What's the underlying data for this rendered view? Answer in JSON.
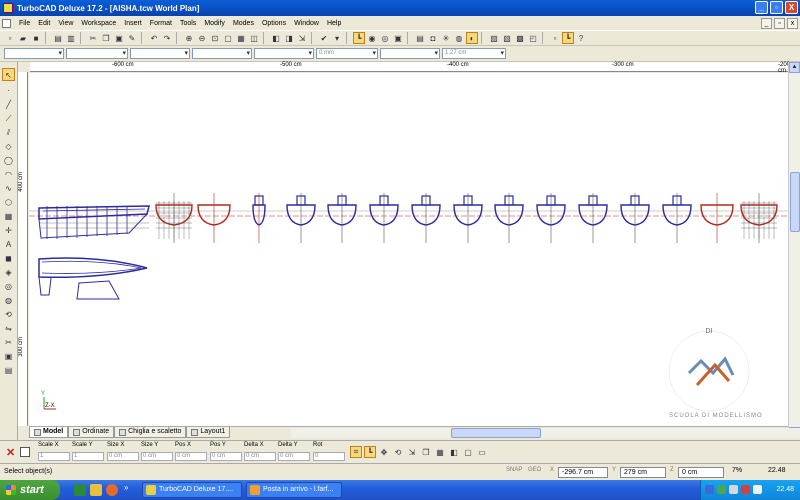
{
  "window": {
    "title": "TurboCAD Deluxe 17.2 - [AISHA.tcw World Plan]",
    "controls": [
      "_",
      "▫",
      "X"
    ]
  },
  "menu": {
    "items": [
      "File",
      "Edit",
      "View",
      "Workspace",
      "Insert",
      "Format",
      "Tools",
      "Modify",
      "Modes",
      "Options",
      "Window",
      "Help"
    ]
  },
  "propbar": {
    "dim_value": "0 mm",
    "dim2_value": "1.27 cm"
  },
  "ruler": {
    "h_labels": [
      "-600 cm",
      "-500 cm",
      "-400 cm",
      "-300 cm",
      "-200 cm"
    ],
    "v_labels": [
      "400 cm",
      "300 cm"
    ]
  },
  "tabs": {
    "items": [
      "Model",
      "Ordinate",
      "Chiglia e scaletto",
      "Layout1"
    ]
  },
  "inspector": {
    "labels": [
      "Scale X",
      "Scale Y",
      "Size X",
      "Size Y",
      "Pos X",
      "Pos Y",
      "Delta X",
      "Delta Y",
      "Rot"
    ],
    "values": [
      "1",
      "1",
      "0 cm",
      "0 cm",
      "0 cm",
      "0 cm",
      "0 cm",
      "0 cm",
      "0"
    ]
  },
  "status": {
    "text": "Select object(s)",
    "snap": "SNAP",
    "geo": "GEO",
    "x_value": "-296.7 cm",
    "y_value": "279 cm",
    "z_value": "0 cm",
    "zoom": "7%",
    "time": "22.48"
  },
  "taskbar": {
    "start_label": "start",
    "tasks": [
      "TurboCAD Deluxe 17....",
      "Posta in arrivo - l.farf..."
    ],
    "clock": "22.48"
  },
  "watermark": {
    "text": "SCUOLA DI MODELLISMO"
  },
  "colors": {
    "hull_blue": "#2b2b9e",
    "section_red": "#b02a1a",
    "titlebar": "#0a5fd8"
  }
}
